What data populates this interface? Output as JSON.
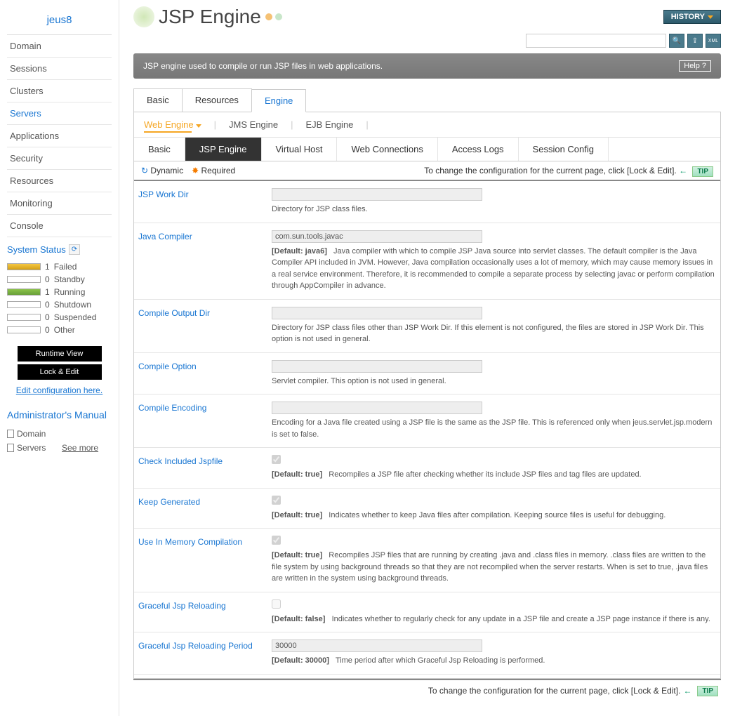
{
  "sidebar": {
    "title": "jeus8",
    "items": [
      {
        "label": "Domain",
        "active": false
      },
      {
        "label": "Sessions",
        "active": false
      },
      {
        "label": "Clusters",
        "active": false
      },
      {
        "label": "Servers",
        "active": true
      },
      {
        "label": "Applications",
        "active": false
      },
      {
        "label": "Security",
        "active": false
      },
      {
        "label": "Resources",
        "active": false
      },
      {
        "label": "Monitoring",
        "active": false
      },
      {
        "label": "Console",
        "active": false
      }
    ],
    "system_status": {
      "title": "System Status",
      "rows": [
        {
          "count": "1",
          "label": "Failed",
          "cls": "status-failed"
        },
        {
          "count": "0",
          "label": "Standby",
          "cls": ""
        },
        {
          "count": "1",
          "label": "Running",
          "cls": "status-running"
        },
        {
          "count": "0",
          "label": "Shutdown",
          "cls": ""
        },
        {
          "count": "0",
          "label": "Suspended",
          "cls": ""
        },
        {
          "count": "0",
          "label": "Other",
          "cls": ""
        }
      ]
    },
    "runtime_btn": "Runtime View",
    "lock_btn": "Lock & Edit",
    "edit_link": "Edit configuration here.",
    "admin": {
      "title": "Administrator's Manual",
      "links": [
        "Domain",
        "Servers"
      ],
      "see_more": "See more"
    }
  },
  "header": {
    "title": "JSP Engine",
    "history": "HISTORY",
    "description": "JSP engine used to compile or run JSP files in web applications.",
    "help": "Help"
  },
  "tabs1": [
    {
      "label": "Basic",
      "active": false
    },
    {
      "label": "Resources",
      "active": false
    },
    {
      "label": "Engine",
      "active": true
    }
  ],
  "subtabs": [
    {
      "label": "Web Engine",
      "active": true
    },
    {
      "label": "JMS Engine",
      "active": false
    },
    {
      "label": "EJB Engine",
      "active": false
    }
  ],
  "subtabs2": [
    {
      "label": "Basic",
      "active": false
    },
    {
      "label": "JSP Engine",
      "active": true
    },
    {
      "label": "Virtual Host",
      "active": false
    },
    {
      "label": "Web Connections",
      "active": false
    },
    {
      "label": "Access Logs",
      "active": false
    },
    {
      "label": "Session Config",
      "active": false
    }
  ],
  "legend": {
    "dynamic": "Dynamic",
    "required": "Required",
    "tip_text": "To change the configuration for the current page, click [Lock & Edit].",
    "tip": "TIP"
  },
  "form": [
    {
      "label": "JSP Work Dir",
      "value": "",
      "help": "Directory for JSP class files.",
      "type": "text"
    },
    {
      "label": "Java Compiler",
      "value": "com.sun.tools.javac",
      "default": "[Default: java6]",
      "help": "Java compiler with which to compile JSP Java source into servlet classes. The default compiler is the Java Compiler API included in JVM. However, Java compilation occasionally uses a lot of memory, which may cause memory issues in a real service environment. Therefore, it is recommended to compile a separate process by selecting javac or perform compilation through AppCompiler in advance.",
      "type": "text"
    },
    {
      "label": "Compile Output Dir",
      "value": "",
      "help": "Directory for JSP class files other than JSP Work Dir. If this element is not configured, the files are stored in JSP Work Dir. This option is not used in general.",
      "type": "text"
    },
    {
      "label": "Compile Option",
      "value": "",
      "help": "Servlet compiler. This option is not used in general.",
      "type": "text"
    },
    {
      "label": "Compile Encoding",
      "value": "",
      "help": "Encoding for a Java file created using a JSP file is the same as the JSP file. This is referenced only when jeus.servlet.jsp.modern is set to false.",
      "type": "text"
    },
    {
      "label": "Check Included Jspfile",
      "checked": true,
      "default": "[Default: true]",
      "help": "Recompiles a JSP file after checking whether its include JSP files and tag files are updated.",
      "type": "check"
    },
    {
      "label": "Keep Generated",
      "checked": true,
      "default": "[Default: true]",
      "help": "Indicates whether to keep Java files after compilation. Keeping source files is useful for debugging.",
      "type": "check"
    },
    {
      "label": "Use In Memory Compilation",
      "checked": true,
      "default": "[Default: true]",
      "help": "Recompiles JSP files that are running by creating .java and .class files in memory. .class files are written to the file system by using background threads so that they are not recompiled when the server restarts. When <keep-generated> is set to true, .java files are written in the system using background threads.",
      "type": "check"
    },
    {
      "label": "Graceful Jsp Reloading",
      "checked": false,
      "default": "[Default: false]",
      "help": "Indicates whether to regularly check for any update in a JSP file and create a JSP page instance if there is any.",
      "type": "check"
    },
    {
      "label": "Graceful Jsp Reloading Period",
      "value": "30000",
      "default": "[Default: 30000]",
      "help": "Time period after which Graceful Jsp Reloading is performed.",
      "type": "text"
    }
  ],
  "footer": {
    "text": "To change the configuration for the current page, click [Lock & Edit].",
    "tip": "TIP"
  }
}
